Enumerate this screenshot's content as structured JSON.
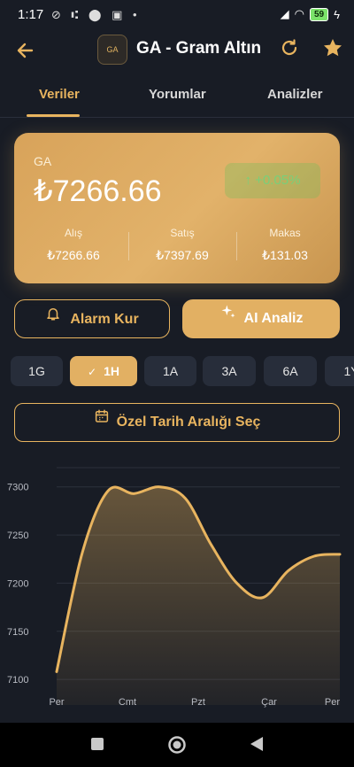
{
  "status_bar": {
    "time": "1:17",
    "battery": "59"
  },
  "header": {
    "logo_text": "GA",
    "title": "GA - Gram Altın"
  },
  "tabs": [
    {
      "label": "Veriler",
      "active": true
    },
    {
      "label": "Yorumlar",
      "active": false
    },
    {
      "label": "Analizler",
      "active": false
    }
  ],
  "price_card": {
    "symbol": "GA",
    "price": "₺7266.66",
    "change": "↑  +0.05%",
    "columns": [
      {
        "label": "Alış",
        "value": "₺7266.66"
      },
      {
        "label": "Satış",
        "value": "₺7397.69"
      },
      {
        "label": "Makas",
        "value": "₺131.03"
      }
    ]
  },
  "actions": {
    "alarm": "Alarm Kur",
    "ai": "AI Analiz"
  },
  "periods": [
    {
      "label": "1G",
      "active": false
    },
    {
      "label": "1H",
      "active": true
    },
    {
      "label": "1A",
      "active": false
    },
    {
      "label": "3A",
      "active": false
    },
    {
      "label": "6A",
      "active": false
    },
    {
      "label": "1Y",
      "active": false
    }
  ],
  "date_range_button": "Özel Tarih Aralığı Seç",
  "colors": {
    "accent": "#e8b45f",
    "background": "#181c25",
    "positive": "#78d07a"
  },
  "chart_data": {
    "type": "area",
    "x": [
      "Per",
      "Cmt",
      "Pzt",
      "Çar",
      "Per"
    ],
    "series": [
      {
        "values": [
          7108,
          7232,
          7296,
          7293,
          7300,
          7288,
          7240,
          7200,
          7185,
          7213,
          7228,
          7230
        ]
      }
    ],
    "y_ticks": [
      7300,
      7250,
      7200,
      7150,
      7100
    ],
    "ylim": [
      7090,
      7320
    ],
    "grid": true
  }
}
